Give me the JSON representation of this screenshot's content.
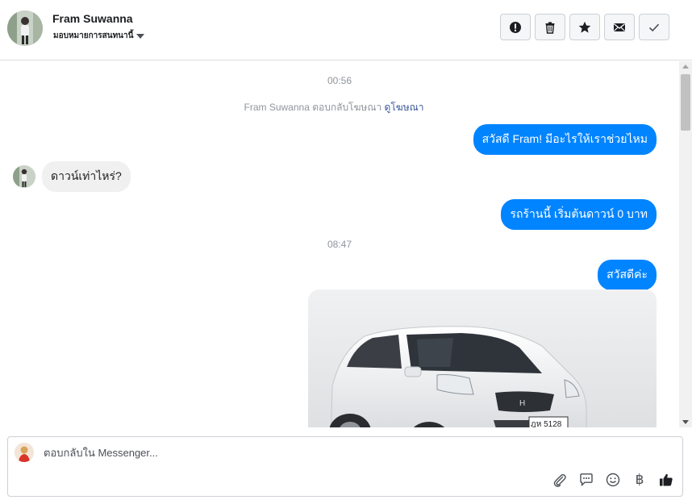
{
  "header": {
    "name": "Fram Suwanna",
    "assign_label": "มอบหมายการสนทนานี้",
    "actions": [
      {
        "name": "spam-icon"
      },
      {
        "name": "trash-icon"
      },
      {
        "name": "star-icon"
      },
      {
        "name": "mail-icon"
      },
      {
        "name": "check-icon"
      }
    ]
  },
  "conversation": {
    "timestamp_1": "00:56",
    "system_prefix": "Fram Suwanna ตอบกลับโฆษณา",
    "system_link": "ดูโฆษณา",
    "msg_out_1": "สวัสดี Fram! มีอะไรให้เราช่วยไหม",
    "msg_in_1": "ดาวน์เท่าไหร่?",
    "msg_out_2": "รถร้านนี้ เริ่มต้นดาวน์ 0 บาท",
    "timestamp_2": "08:47",
    "msg_out_3": "สวัสดีค่ะ",
    "photo_plate": "ฎห 5128"
  },
  "composer": {
    "placeholder": "ตอบกลับใน Messenger...",
    "tools": [
      "paperclip-icon",
      "saved-reply-icon",
      "emoji-icon",
      "baht-icon",
      "thumbs-up-icon"
    ],
    "baht_symbol": "฿"
  },
  "colors": {
    "outgoing_bubble": "#0084ff",
    "incoming_bubble": "#f1f0f0",
    "link": "#385898"
  }
}
